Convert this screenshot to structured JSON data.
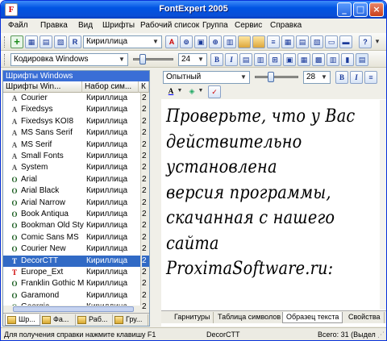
{
  "window": {
    "title": "FontExpert 2005"
  },
  "menu": [
    "Файл",
    "Правка",
    "Вид",
    "Шрифты",
    "Рабочий список",
    "Группа",
    "Сервис",
    "Справка"
  ],
  "toolbar1": {
    "charset_value": "Кириллица"
  },
  "toolbar2": {
    "encoding_value": "Кодировка Windows",
    "size_value": "24"
  },
  "left_pane": {
    "header": "Шрифты Windows",
    "columns": [
      "Шрифты Win...",
      "Набор сим...",
      "К"
    ],
    "fonts": [
      {
        "name": "Courier",
        "charset": "Кириллица",
        "extra": "2",
        "icon": "A",
        "kind": "raster"
      },
      {
        "name": "Fixedsys",
        "charset": "Кириллица",
        "extra": "2",
        "icon": "A",
        "kind": "raster"
      },
      {
        "name": "Fixedsys KOI8",
        "charset": "Кириллица",
        "extra": "2",
        "icon": "A",
        "kind": "raster"
      },
      {
        "name": "MS Sans Serif",
        "charset": "Кириллица",
        "extra": "2",
        "icon": "A",
        "kind": "raster"
      },
      {
        "name": "MS Serif",
        "charset": "Кириллица",
        "extra": "2",
        "icon": "A",
        "kind": "raster"
      },
      {
        "name": "Small Fonts",
        "charset": "Кириллица",
        "extra": "2",
        "icon": "A",
        "kind": "raster"
      },
      {
        "name": "System",
        "charset": "Кириллица",
        "extra": "2",
        "icon": "A",
        "kind": "raster"
      },
      {
        "name": "Arial",
        "charset": "Кириллица",
        "extra": "2",
        "icon": "O",
        "kind": "opentype"
      },
      {
        "name": "Arial Black",
        "charset": "Кириллица",
        "extra": "2",
        "icon": "O",
        "kind": "opentype"
      },
      {
        "name": "Arial Narrow",
        "charset": "Кириллица",
        "extra": "2",
        "icon": "O",
        "kind": "opentype"
      },
      {
        "name": "Book Antiqua",
        "charset": "Кириллица",
        "extra": "2",
        "icon": "O",
        "kind": "opentype"
      },
      {
        "name": "Bookman Old Style",
        "charset": "Кириллица",
        "extra": "2",
        "icon": "O",
        "kind": "opentype"
      },
      {
        "name": "Comic Sans MS",
        "charset": "Кириллица",
        "extra": "2",
        "icon": "O",
        "kind": "opentype"
      },
      {
        "name": "Courier New",
        "charset": "Кириллица",
        "extra": "2",
        "icon": "O",
        "kind": "opentype"
      },
      {
        "name": "DecorCTT",
        "charset": "Кириллица",
        "extra": "2",
        "icon": "T",
        "kind": "truetype",
        "selected": true
      },
      {
        "name": "Europe_Ext",
        "charset": "Кириллица",
        "extra": "2",
        "icon": "T",
        "kind": "truetype"
      },
      {
        "name": "Franklin Gothic M...",
        "charset": "Кириллица",
        "extra": "2",
        "icon": "O",
        "kind": "opentype"
      },
      {
        "name": "Garamond",
        "charset": "Кириллица",
        "extra": "2",
        "icon": "O",
        "kind": "opentype"
      },
      {
        "name": "Georgia",
        "charset": "Кириллица",
        "extra": "2",
        "icon": "O",
        "kind": "opentype"
      }
    ],
    "tabs": [
      "Шр...",
      "Фа...",
      "Раб...",
      "Гру..."
    ]
  },
  "right_pane": {
    "style_value": "Опытный",
    "size_value": "28",
    "preview_lines": [
      "Проверьте, что у Вас",
      "действительно",
      "установлена",
      "версия программы,",
      "скачанная с нашего",
      "сайта",
      "ProximaSoftware.ru:"
    ],
    "tabs": [
      "Гарнитуры",
      "Таблица символов",
      "Образец текста",
      "Свойства"
    ]
  },
  "status": {
    "help": "Для получения справки нажмите клавишу F1",
    "font": "DecorCTT",
    "total": "Всего: 31 (Выдел"
  },
  "colors": {
    "selection": "#316ac5",
    "titlebar": "#0054e3"
  }
}
